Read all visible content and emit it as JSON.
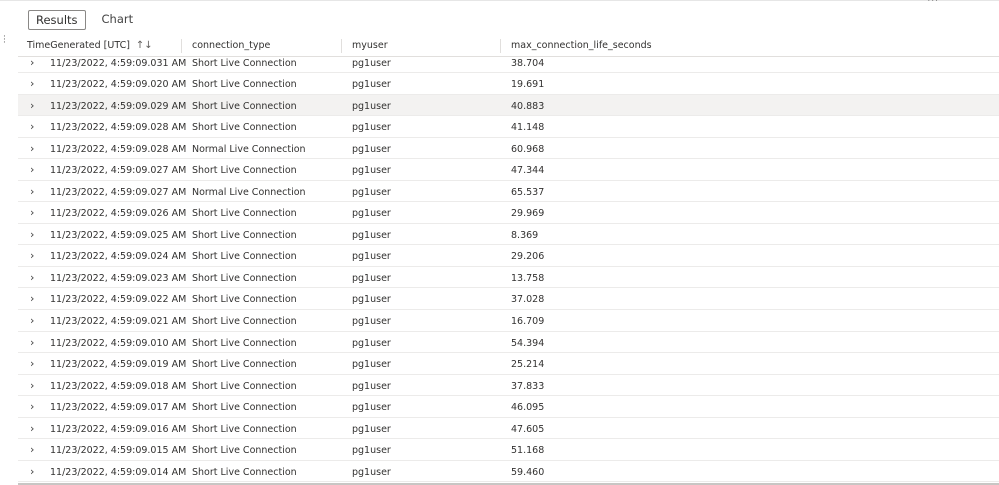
{
  "tabs": [
    {
      "label": "Results",
      "active": true
    },
    {
      "label": "Chart",
      "active": false
    }
  ],
  "columns": {
    "time": "TimeGenerated [UTC]",
    "type": "connection_type",
    "user": "myuser",
    "max": "max_connection_life_seconds"
  },
  "icons": {
    "sort": "sort-icon",
    "expand": "chevron-right-icon"
  },
  "rows": [
    {
      "time": "11/23/2022, 4:59:09.031 AM",
      "type": "Short Live Connection",
      "user": "pg1user",
      "max": "38.704"
    },
    {
      "time": "11/23/2022, 4:59:09.020 AM",
      "type": "Short Live Connection",
      "user": "pg1user",
      "max": "19.691"
    },
    {
      "time": "11/23/2022, 4:59:09.029 AM",
      "type": "Short Live Connection",
      "user": "pg1user",
      "max": "40.883"
    },
    {
      "time": "11/23/2022, 4:59:09.028 AM",
      "type": "Short Live Connection",
      "user": "pg1user",
      "max": "41.148"
    },
    {
      "time": "11/23/2022, 4:59:09.028 AM",
      "type": "Normal Live Connection",
      "user": "pg1user",
      "max": "60.968"
    },
    {
      "time": "11/23/2022, 4:59:09.027 AM",
      "type": "Short Live Connection",
      "user": "pg1user",
      "max": "47.344"
    },
    {
      "time": "11/23/2022, 4:59:09.027 AM",
      "type": "Normal Live Connection",
      "user": "pg1user",
      "max": "65.537"
    },
    {
      "time": "11/23/2022, 4:59:09.026 AM",
      "type": "Short Live Connection",
      "user": "pg1user",
      "max": "29.969"
    },
    {
      "time": "11/23/2022, 4:59:09.025 AM",
      "type": "Short Live Connection",
      "user": "pg1user",
      "max": "8.369"
    },
    {
      "time": "11/23/2022, 4:59:09.024 AM",
      "type": "Short Live Connection",
      "user": "pg1user",
      "max": "29.206"
    },
    {
      "time": "11/23/2022, 4:59:09.023 AM",
      "type": "Short Live Connection",
      "user": "pg1user",
      "max": "13.758"
    },
    {
      "time": "11/23/2022, 4:59:09.022 AM",
      "type": "Short Live Connection",
      "user": "pg1user",
      "max": "37.028"
    },
    {
      "time": "11/23/2022, 4:59:09.021 AM",
      "type": "Short Live Connection",
      "user": "pg1user",
      "max": "16.709"
    },
    {
      "time": "11/23/2022, 4:59:09.010 AM",
      "type": "Short Live Connection",
      "user": "pg1user",
      "max": "54.394"
    },
    {
      "time": "11/23/2022, 4:59:09.019 AM",
      "type": "Short Live Connection",
      "user": "pg1user",
      "max": "25.214"
    },
    {
      "time": "11/23/2022, 4:59:09.018 AM",
      "type": "Short Live Connection",
      "user": "pg1user",
      "max": "37.833"
    },
    {
      "time": "11/23/2022, 4:59:09.017 AM",
      "type": "Short Live Connection",
      "user": "pg1user",
      "max": "46.095"
    },
    {
      "time": "11/23/2022, 4:59:09.016 AM",
      "type": "Short Live Connection",
      "user": "pg1user",
      "max": "47.605"
    },
    {
      "time": "11/23/2022, 4:59:09.015 AM",
      "type": "Short Live Connection",
      "user": "pg1user",
      "max": "51.168"
    },
    {
      "time": "11/23/2022, 4:59:09.014 AM",
      "type": "Short Live Connection",
      "user": "pg1user",
      "max": "59.460"
    }
  ],
  "highlighted_row": 2
}
